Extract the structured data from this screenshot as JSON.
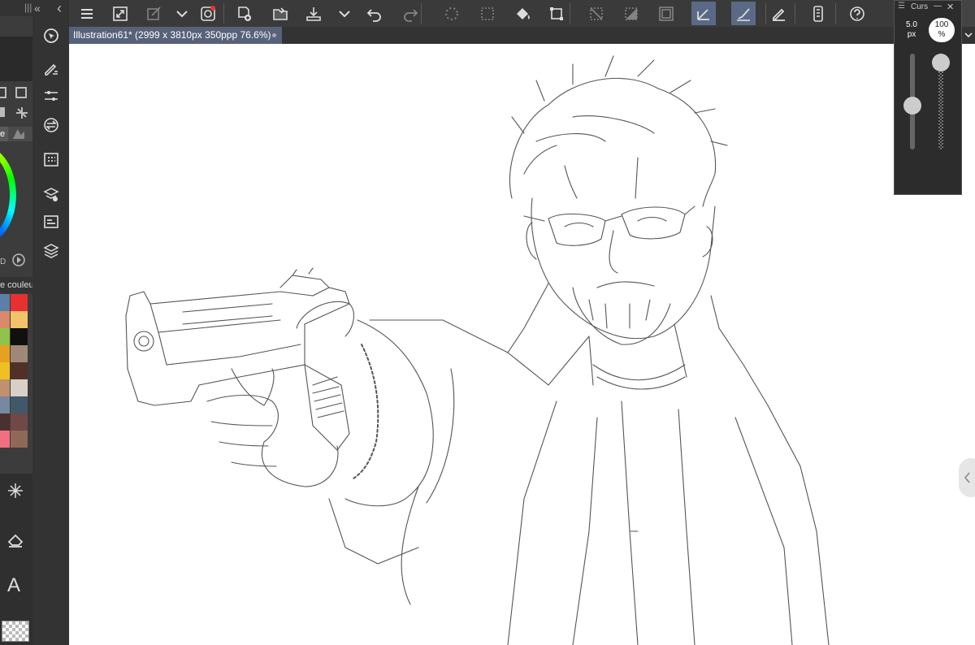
{
  "window": {
    "collapse_glyph": "«",
    "nav_prev_glyph": "‹",
    "grip_glyph": "|||"
  },
  "toolbar": {
    "items": [
      {
        "icon": "menu-icon"
      },
      {
        "icon": "fullscreen-icon"
      },
      {
        "icon": "quick-access-icon",
        "dim": true
      },
      {
        "icon": "chevron-down-icon"
      },
      {
        "icon": "clip-studio-icon"
      },
      {
        "icon": "new-file-icon"
      },
      {
        "icon": "open-folder-icon"
      },
      {
        "icon": "save-icon"
      },
      {
        "icon": "chevron-down-icon"
      },
      {
        "icon": "undo-icon"
      },
      {
        "icon": "redo-icon",
        "dim": true
      },
      {
        "icon": "loading-icon",
        "dim": true
      },
      {
        "icon": "select-icon",
        "dim": true
      },
      {
        "icon": "fill-icon"
      },
      {
        "icon": "transform-icon"
      },
      {
        "icon": "deselect-icon",
        "dim": true
      },
      {
        "icon": "invert-selection-icon",
        "dim": true
      },
      {
        "icon": "select-border-icon",
        "dim": true
      },
      {
        "icon": "stabilizer-icon",
        "active": true
      },
      {
        "icon": "brush-icon",
        "active": true
      },
      {
        "icon": "pen-pressure-icon"
      },
      {
        "icon": "tablet-icon"
      },
      {
        "icon": "help-icon"
      }
    ]
  },
  "document_tab": {
    "title": "Illustration61* (2999 x 3810px 350ppp 76.6%)"
  },
  "left_panel": {
    "color_palette_label": "e couleu",
    "text_tool_glyph": "A",
    "tab_label": "e",
    "palette_colors": [
      [
        "#5b7fa8",
        "#e83030"
      ],
      [
        "#d98a6a",
        "#f3c36a"
      ],
      [
        "#8fc34a",
        "#101010"
      ],
      [
        "#e8a020",
        "#a08878"
      ],
      [
        "#f0c020",
        "#503028"
      ],
      [
        "#c09070",
        "#d8d0c8"
      ],
      [
        "#7888a0",
        "#405868"
      ],
      [
        "#4a3030",
        "#704848"
      ],
      [
        "#f07080",
        "#906858"
      ]
    ]
  },
  "icon_column": {
    "items": [
      "navigator-icon",
      "tool-property-icon",
      "color-adjust-icon",
      "color-swap-icon",
      "material-icon",
      "layer-property-icon",
      "timeline-icon",
      "layers-icon"
    ]
  },
  "cursor_panel": {
    "title": "Curs",
    "size_value": "5.0",
    "size_unit": "px",
    "opacity_value": "100",
    "opacity_unit": "%",
    "size_level": 0.45,
    "opacity_level": 1.0,
    "close_glyph": "✕",
    "minimize_glyph": "—",
    "menu_glyph": "☰"
  }
}
